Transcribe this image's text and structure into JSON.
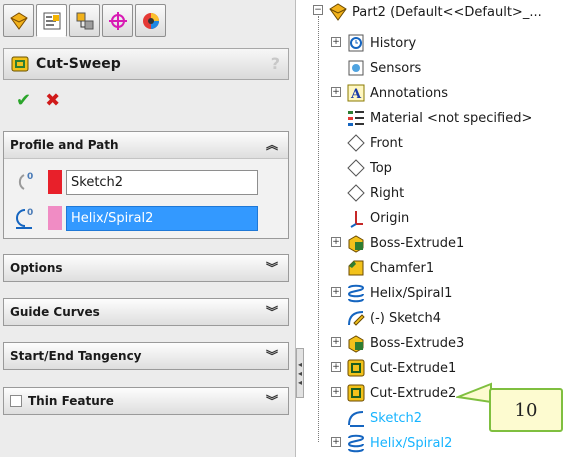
{
  "property_manager": {
    "title": "Cut-Sweep",
    "help": "?",
    "ok_glyph": "✔",
    "cancel_glyph": "✖",
    "groups": {
      "profile_and_path": {
        "label": "Profile and Path",
        "profile_value": "Sketch2",
        "path_value": "Helix/Spiral2",
        "profile_color": "#e8202a",
        "path_color": "#f08cc4"
      },
      "options": {
        "label": "Options"
      },
      "guide_curves": {
        "label": "Guide Curves"
      },
      "tangency": {
        "label": "Start/End Tangency"
      },
      "thin_feature": {
        "label": "Thin Feature"
      }
    },
    "chevron_up": "≈",
    "chevron_down": "≈"
  },
  "tree": {
    "root": "Part2  (Default<<Default>_...",
    "items": [
      "History",
      "Sensors",
      "Annotations",
      "Material <not specified>",
      "Front",
      "Top",
      "Right",
      "Origin",
      "Boss-Extrude1",
      "Chamfer1",
      "Helix/Spiral1",
      "(-) Sketch4",
      "Boss-Extrude3",
      "Cut-Extrude1",
      "Cut-Extrude2",
      "Sketch2",
      "Helix/Spiral2"
    ]
  },
  "callout": {
    "label": "10"
  },
  "colors": {
    "accent_selection": "#3399ff",
    "highlight_tree": "#17b4ff"
  }
}
